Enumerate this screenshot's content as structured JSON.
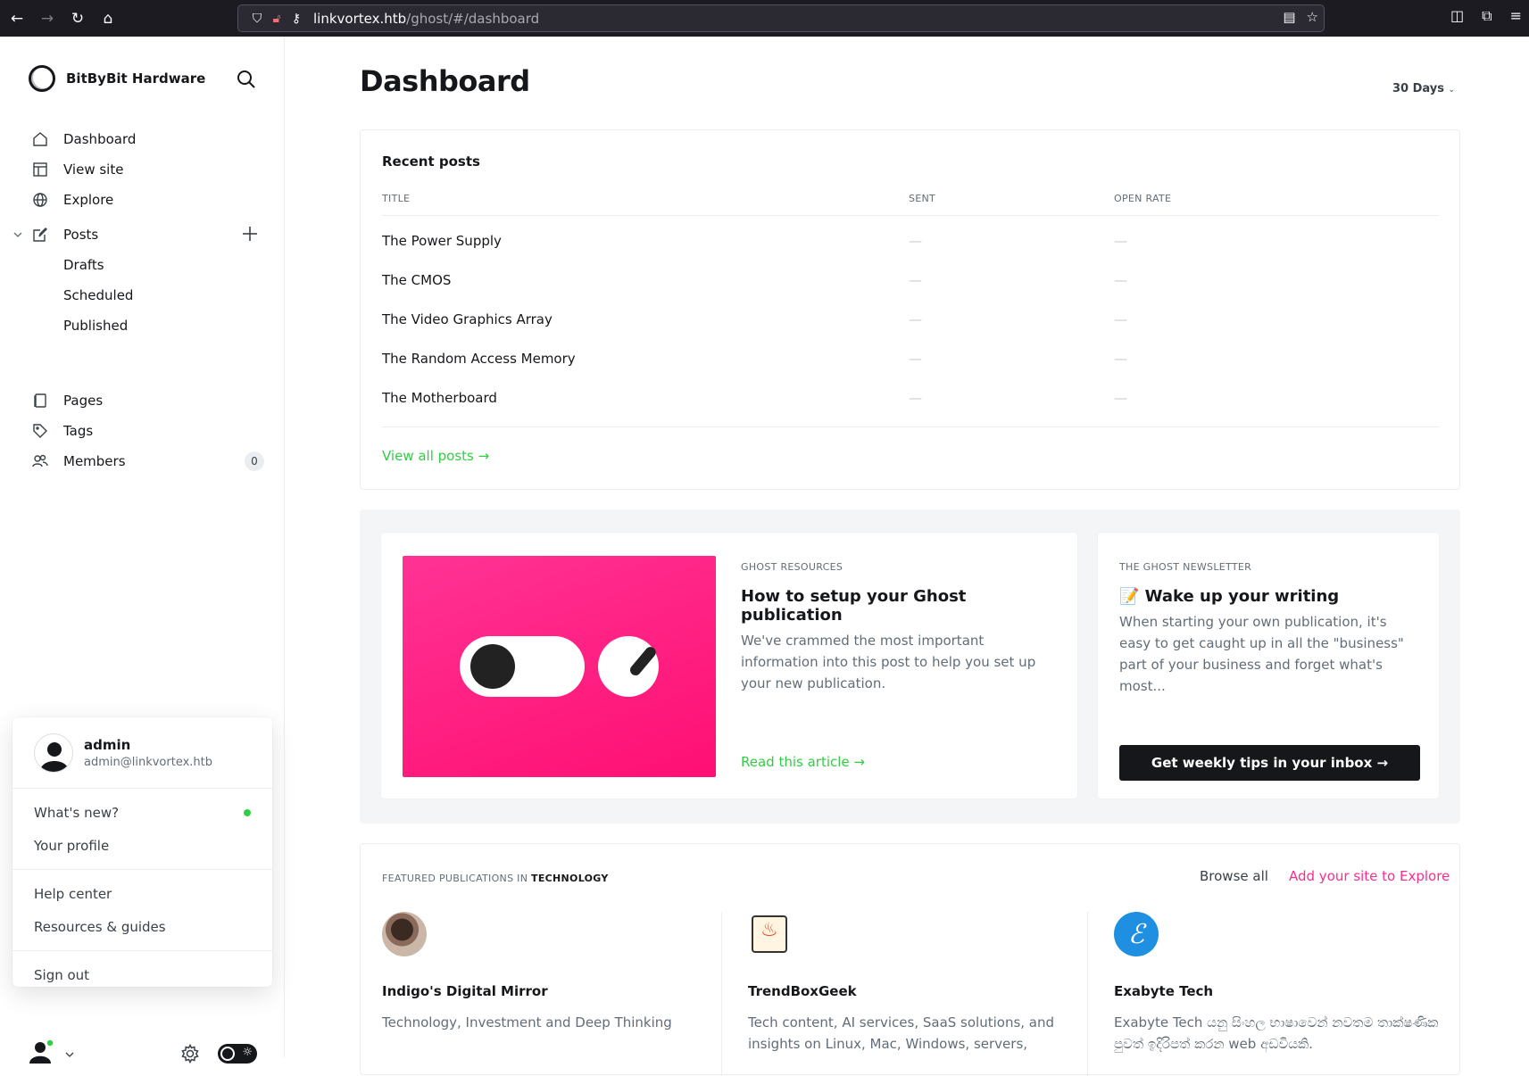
{
  "browser": {
    "url_host": "linkvortex.htb",
    "url_path": "/ghost/#/dashboard"
  },
  "sidebar": {
    "brand": "BitByBit Hardware",
    "nav": [
      {
        "label": "Dashboard",
        "icon": "home-icon"
      },
      {
        "label": "View site",
        "icon": "layout-icon"
      },
      {
        "label": "Explore",
        "icon": "globe-icon"
      }
    ],
    "posts": {
      "label": "Posts",
      "sub": [
        "Drafts",
        "Scheduled",
        "Published"
      ]
    },
    "nav2": [
      {
        "label": "Pages",
        "icon": "pages-icon"
      },
      {
        "label": "Tags",
        "icon": "tag-icon"
      },
      {
        "label": "Members",
        "icon": "members-icon",
        "badge": "0"
      }
    ]
  },
  "user_menu": {
    "name": "admin",
    "email": "admin@linkvortex.htb",
    "items1": [
      "What's new?",
      "Your profile"
    ],
    "items2": [
      "Help center",
      "Resources & guides"
    ],
    "signout": "Sign out"
  },
  "main": {
    "title": "Dashboard",
    "range": "30 Days",
    "recent": {
      "title": "Recent posts",
      "columns": [
        "TITLE",
        "SENT",
        "OPEN RATE"
      ],
      "rows": [
        {
          "title": "The Power Supply",
          "sent": "—",
          "open": "—"
        },
        {
          "title": "The CMOS",
          "sent": "—",
          "open": "—"
        },
        {
          "title": "The Video Graphics Array",
          "sent": "—",
          "open": "—"
        },
        {
          "title": "The Random Access Memory",
          "sent": "—",
          "open": "—"
        },
        {
          "title": "The Motherboard",
          "sent": "—",
          "open": "—"
        }
      ],
      "view_all": "View all posts →"
    },
    "resources": {
      "kicker": "GHOST RESOURCES",
      "heading": "How to setup your Ghost publication",
      "body": "We've crammed the most important information into this post to help you set up your new publication.",
      "link": "Read this article →"
    },
    "newsletter": {
      "kicker": "THE GHOST NEWSLETTER",
      "heading": "📝 Wake up your writing",
      "body": "When starting your own publication, it's easy to get caught up in all the \"business\" part of your business and forget what's most...",
      "button": "Get weekly tips in your inbox →"
    },
    "featured": {
      "prefix": "FEATURED PUBLICATIONS IN",
      "category": "TECHNOLOGY",
      "browse": "Browse all",
      "add_site": "Add your site to Explore",
      "pubs": [
        {
          "name": "Indigo's Digital Mirror",
          "desc": "Technology, Investment and Deep Thinking"
        },
        {
          "name": "TrendBoxGeek",
          "desc": "Tech content, AI services, SaaS solutions, and insights on Linux, Mac, Windows, servers,"
        },
        {
          "name": "Exabyte Tech",
          "desc": "Exabyte Tech යනු සිංහල භාෂාවෙන් නවතම තාක්ෂණික පුවත් ඉදිරිපත් කරන web අඩවියකි."
        }
      ]
    }
  },
  "colors": {
    "accent_green": "#30cf43",
    "accent_pink": "#fb2d8d",
    "dark": "#15171a"
  }
}
